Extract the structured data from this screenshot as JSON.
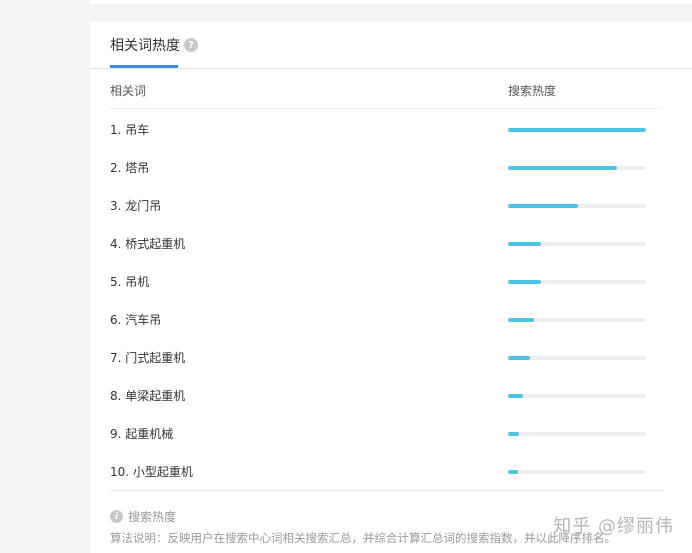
{
  "tab": {
    "label": "相关词热度",
    "help": "?"
  },
  "columns": {
    "term": "相关词",
    "heat": "搜索热度"
  },
  "rows": [
    {
      "label": "1.  吊车",
      "heat": 1.0
    },
    {
      "label": "2.  塔吊",
      "heat": 0.79
    },
    {
      "label": "3.  龙门吊",
      "heat": 0.51
    },
    {
      "label": "4.  桥式起重机",
      "heat": 0.24
    },
    {
      "label": "5.  吊机",
      "heat": 0.24
    },
    {
      "label": "6.  汽车吊",
      "heat": 0.19
    },
    {
      "label": "7.  门式起重机",
      "heat": 0.16
    },
    {
      "label": "8.  单梁起重机",
      "heat": 0.11
    },
    {
      "label": "9.  起重机械",
      "heat": 0.08
    },
    {
      "label": "10. 小型起重机",
      "heat": 0.07
    }
  ],
  "footer": {
    "info": "i",
    "title": "搜索热度",
    "description": "算法说明：反映用户在搜索中心词相关搜索汇总，并综合计算汇总词的搜索指数，并以此降序排名。"
  },
  "watermark": "知乎 @缪丽伟",
  "colors": {
    "accent": "#3c8dde",
    "bar": "#4ec3e6",
    "track": "#eeeeee"
  }
}
